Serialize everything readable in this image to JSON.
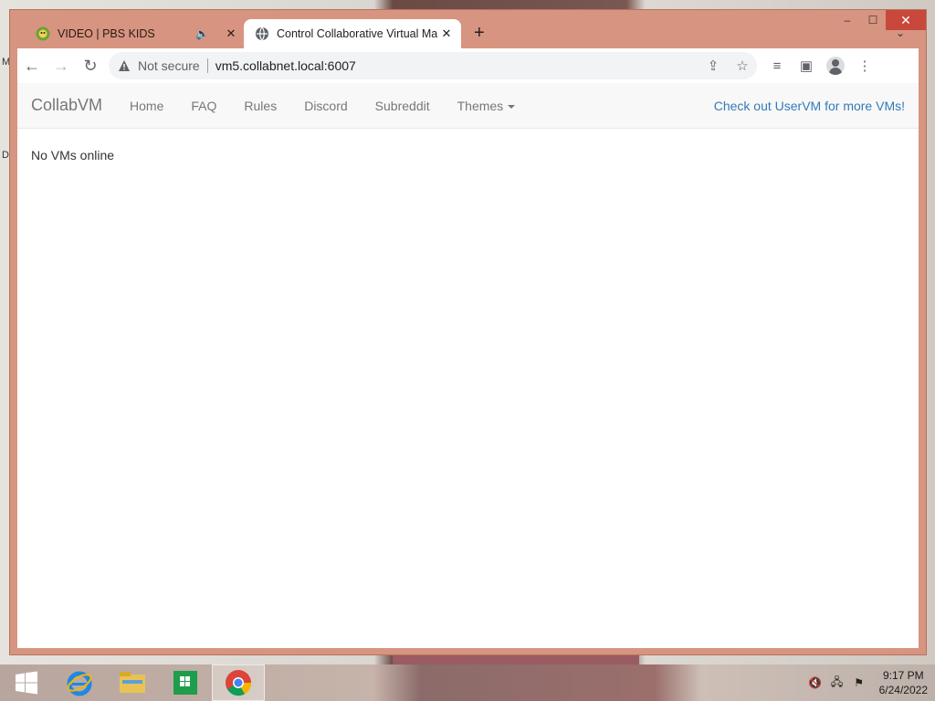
{
  "desktop": {
    "edge_letters": [
      "M",
      "D"
    ]
  },
  "window": {
    "controls": {
      "minimize": "–",
      "maximize": "☐",
      "close": "✕"
    }
  },
  "tabs": [
    {
      "title": "VIDEO | PBS KIDS",
      "favicon": "pbs-kids-icon",
      "audio": true,
      "active": false
    },
    {
      "title": "Control Collaborative Virtual Ma",
      "favicon": "globe-icon",
      "audio": false,
      "active": true
    }
  ],
  "toolbar": {
    "security_label": "Not secure",
    "url": "vm5.collabnet.local:6007"
  },
  "page": {
    "brand": "CollabVM",
    "nav": [
      "Home",
      "FAQ",
      "Rules",
      "Discord",
      "Subreddit",
      "Themes"
    ],
    "right_link": "Check out UserVM for more VMs!",
    "content": "No VMs online"
  },
  "taskbar": {
    "apps": [
      "windows-start-icon",
      "internet-explorer-icon",
      "file-explorer-icon",
      "store-icon",
      "chrome-icon"
    ],
    "clock": {
      "time": "9:17 PM",
      "date": "6/24/2022"
    }
  },
  "colors": {
    "window_frame": "#d79480",
    "link": "#337ab7",
    "close_button": "#c8483c"
  }
}
